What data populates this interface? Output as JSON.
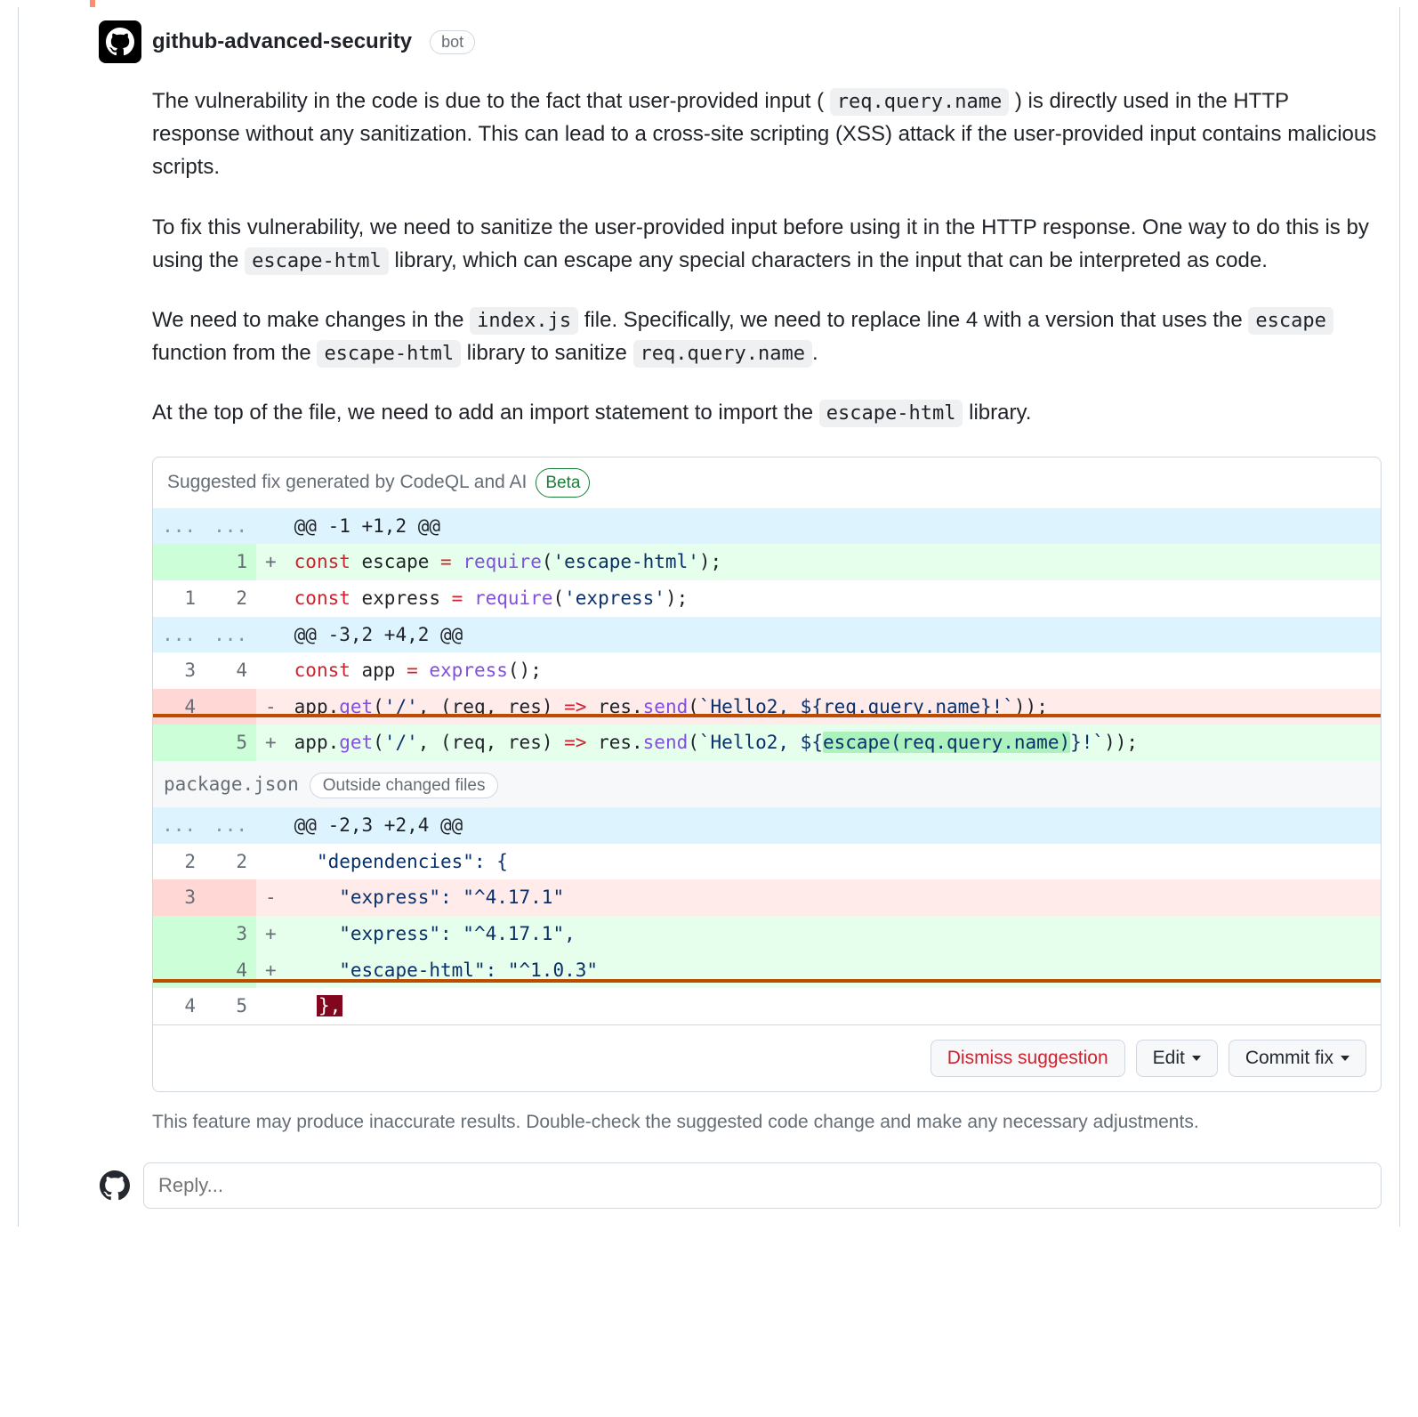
{
  "author": {
    "name": "github-advanced-security",
    "bot_label": "bot"
  },
  "paragraphs": {
    "p1a": "The vulnerability in the code is due to the fact that user-provided input (",
    "p1_code": "req.query.name",
    "p1b": ") is directly used in the HTTP response without any sanitization. This can lead to a cross-site scripting (XSS) attack if the user-provided input contains malicious scripts.",
    "p2a": "To fix this vulnerability, we need to sanitize the user-provided input before using it in the HTTP response. One way to do this is by using the ",
    "p2_code": "escape-html",
    "p2b": " library, which can escape any special characters in the input that can be interpreted as code.",
    "p3a": "We need to make changes in the ",
    "p3_code1": "index.js",
    "p3b": " file. Specifically, we need to replace line 4 with a version that uses the ",
    "p3_code2": "escape",
    "p3c": " function from the ",
    "p3_code3": "escape-html",
    "p3d": " library to sanitize ",
    "p3_code4": "req.query.name",
    "p3e": ".",
    "p4a": "At the top of the file, we need to add an import statement to import the ",
    "p4_code": "escape-html",
    "p4b": " library."
  },
  "suggestion": {
    "title": "Suggested fix generated by CodeQL and AI",
    "beta": "Beta",
    "file2": "package.json",
    "outside_label": "Outside changed files"
  },
  "diff1": {
    "h1": "@@ -1 +1,2 @@",
    "r1_new": "1",
    "r1_kw": "const",
    "r1_name": " escape ",
    "r1_eq": "=",
    "r1_req": " require",
    "r1_paren": "(",
    "r1_str": "'escape-html'",
    "r1_end": ");",
    "r2_old": "1",
    "r2_new": "2",
    "r2_kw": "const",
    "r2_name": " express ",
    "r2_eq": "=",
    "r2_req": " require",
    "r2_paren": "(",
    "r2_str": "'express'",
    "r2_end": ");",
    "h2": "@@ -3,2 +4,2 @@",
    "r3_old": "3",
    "r3_new": "4",
    "r3_kw": "const",
    "r3_name": " app ",
    "r3_eq": "=",
    "r3_fn": " express",
    "r3_end": "();",
    "r4_old": "4",
    "r4_a": "app.",
    "r4_get": "get",
    "r4_b": "(",
    "r4_s1": "'/'",
    "r4_c": ", (req, res) ",
    "r4_arrow": "=>",
    "r4_d": " res.",
    "r4_send": "send",
    "r4_e": "(",
    "r4_tpl": "`Hello2, ${req.query.name}!`",
    "r4_f": "));",
    "r5_new": "5",
    "r5_a": "app.",
    "r5_get": "get",
    "r5_b": "(",
    "r5_s1": "'/'",
    "r5_c": ", (req, res) ",
    "r5_arrow": "=>",
    "r5_d": " res.",
    "r5_send": "send",
    "r5_e": "(",
    "r5_pre": "`Hello2, ${",
    "r5_hl": "escape(req.query.name)",
    "r5_post": "}!`",
    "r5_f": "));"
  },
  "diff2": {
    "h1": "@@ -2,3 +2,4 @@",
    "r1_old": "2",
    "r1_new": "2",
    "r1": "  \"dependencies\": {",
    "r2_old": "3",
    "r2": "    \"express\": \"^4.17.1\"",
    "r3_new": "3",
    "r3": "    \"express\": \"^4.17.1\",",
    "r4_new": "4",
    "r4": "    \"escape-html\": \"^1.0.3\"",
    "r5_old": "4",
    "r5_new": "5",
    "r5a": "  ",
    "r5b": "},"
  },
  "actions": {
    "dismiss": "Dismiss suggestion",
    "edit": "Edit",
    "commit": "Commit fix"
  },
  "disclaimer": "This feature may produce inaccurate results. Double-check the suggested code change and make any necessary adjustments.",
  "reply_placeholder": "Reply..."
}
